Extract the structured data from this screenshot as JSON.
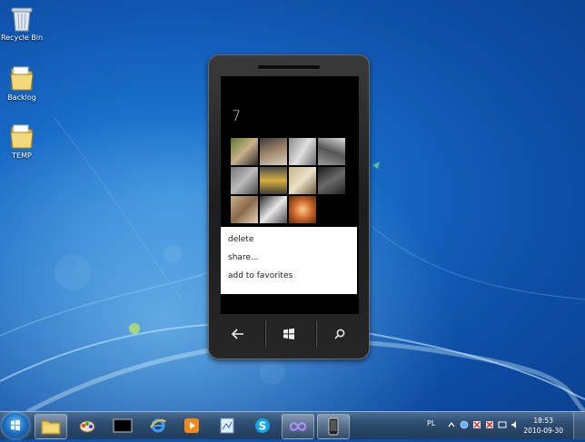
{
  "desktop": {
    "icons": [
      {
        "label": "Recycle Bin",
        "icon": "recycle-bin-icon"
      },
      {
        "label": "Backlog",
        "icon": "folder-icon"
      },
      {
        "label": "TEMP",
        "icon": "folder-icon"
      }
    ]
  },
  "phone": {
    "album_title": "7",
    "context_menu": [
      {
        "label": "delete"
      },
      {
        "label": "share..."
      },
      {
        "label": "add to favorites"
      }
    ],
    "hardware_buttons": [
      "back-icon",
      "windows-start-icon",
      "search-icon"
    ]
  },
  "taskbar": {
    "pinned": [
      "windows-explorer-icon",
      "paint-icon",
      "console-icon",
      "internet-explorer-icon",
      "media-player-icon",
      "document-icon",
      "skype-icon",
      "visual-studio-icon",
      "phone-emulator-icon"
    ],
    "language": "PL",
    "time": "18:53",
    "date": "2010-09-30"
  },
  "colors": {
    "wallpaper": "#1667c3",
    "taskbar": "#2d4d72",
    "menu_bg": "#ffffff",
    "screen_bg": "#000000"
  }
}
